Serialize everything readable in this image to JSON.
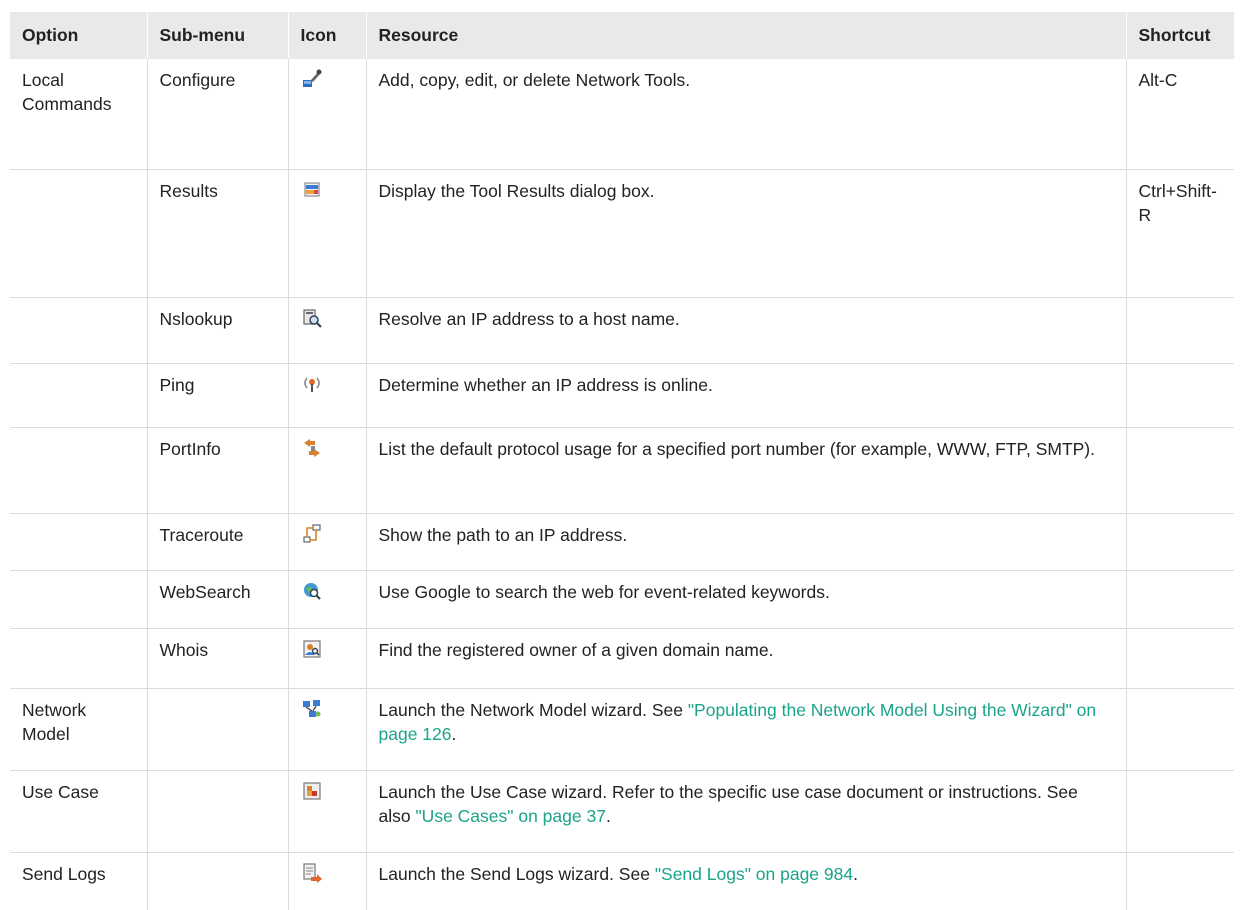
{
  "headers": {
    "option": "Option",
    "submenu": "Sub-menu",
    "icon": "Icon",
    "resource": "Resource",
    "shortcut": "Shortcut"
  },
  "rows": [
    {
      "option": "Local Commands",
      "submenu": "Configure",
      "icon": "configure-tools-icon",
      "resource": "Add, copy, edit, or delete Network Tools.",
      "shortcut": "Alt-C"
    },
    {
      "option": "",
      "submenu": "Results",
      "icon": "tool-results-icon",
      "resource": "Display the Tool Results dialog box.",
      "shortcut": "Ctrl+Shift-R"
    },
    {
      "option": "",
      "submenu": "Nslookup",
      "icon": "nslookup-icon",
      "resource": "Resolve an IP address to a host name.",
      "shortcut": ""
    },
    {
      "option": "",
      "submenu": "Ping",
      "icon": "ping-icon",
      "resource": "Determine whether an IP address is online.",
      "shortcut": ""
    },
    {
      "option": "",
      "submenu": "PortInfo",
      "icon": "portinfo-icon",
      "resource": "List the default protocol usage for a specified port number (for example, WWW, FTP, SMTP).",
      "shortcut": ""
    },
    {
      "option": "",
      "submenu": "Traceroute",
      "icon": "traceroute-icon",
      "resource": "Show the path to an IP address.",
      "shortcut": ""
    },
    {
      "option": "",
      "submenu": "WebSearch",
      "icon": "websearch-icon",
      "resource": "Use Google to search the web for event-related keywords.",
      "shortcut": ""
    },
    {
      "option": "",
      "submenu": "Whois",
      "icon": "whois-icon",
      "resource": "Find the registered owner of a given domain name.",
      "shortcut": ""
    },
    {
      "option": "Network Model",
      "submenu": "",
      "icon": "network-model-icon",
      "resource": "Launch the Network Model wizard. See ",
      "link": "\"Populating the Network Model Using the Wizard\" on page 126",
      "resource_after": ".",
      "shortcut": ""
    },
    {
      "option": "Use Case",
      "submenu": "",
      "icon": "use-case-icon",
      "resource": "Launch the Use Case wizard. Refer to the specific use case document or instructions. See also ",
      "link": "\"Use Cases\" on page 37",
      "resource_after": ".",
      "shortcut": ""
    },
    {
      "option": "Send Logs",
      "submenu": "",
      "icon": "send-logs-icon",
      "resource": "Launch the Send Logs wizard. See ",
      "link": "\"Send Logs\" on page 984",
      "resource_after": ".",
      "shortcut": ""
    }
  ],
  "colors": {
    "link": "#1aa48a",
    "header_bg": "#e9e9e9",
    "grid": "#dcdcdc"
  }
}
